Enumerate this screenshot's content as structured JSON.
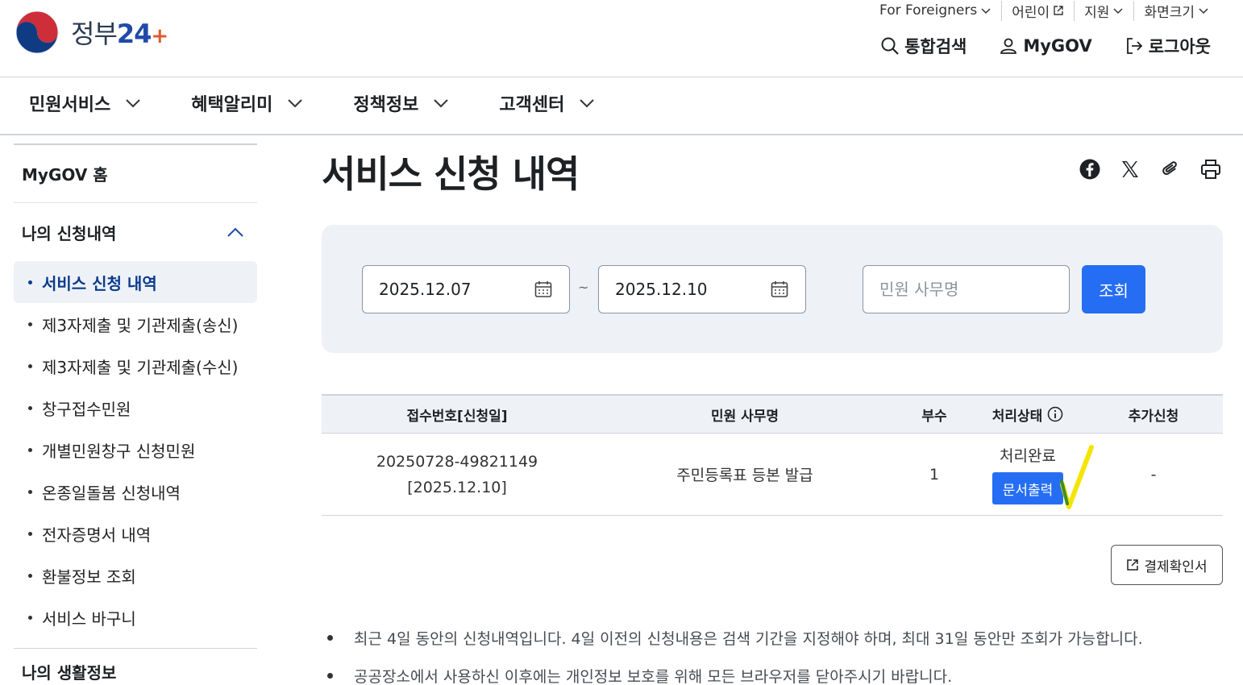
{
  "header": {
    "logo_text": "정부",
    "logo_num": "24",
    "logo_plus": "+",
    "util": [
      {
        "label": "For Foreigners",
        "icon": "chevron-down-icon"
      },
      {
        "label": "어린이",
        "icon": "external-link-icon"
      },
      {
        "label": "지원",
        "icon": "chevron-down-icon"
      },
      {
        "label": "화면크기",
        "icon": "chevron-down-icon"
      }
    ],
    "main_util": [
      {
        "label": "통합검색",
        "icon": "search-icon"
      },
      {
        "label": "MyGOV",
        "icon": "user-icon"
      },
      {
        "label": "로그아웃",
        "icon": "logout-icon"
      }
    ]
  },
  "gnb": [
    "민원서비스",
    "혜택알리미",
    "정책정보",
    "고객센터"
  ],
  "sidebar": {
    "home": "MyGOV 홈",
    "group": "나의 신청내역",
    "items": [
      {
        "label": "서비스 신청 내역",
        "active": true
      },
      {
        "label": "제3자제출 및 기관제출(송신)"
      },
      {
        "label": "제3자제출 및 기관제출(수신)"
      },
      {
        "label": "창구접수민원"
      },
      {
        "label": "개별민원창구 신청민원"
      },
      {
        "label": "온종일돌봄 신청내역"
      },
      {
        "label": "전자증명서 내역"
      },
      {
        "label": "환불정보 조회"
      },
      {
        "label": "서비스 바구니"
      }
    ],
    "group2": "나의 생활정보"
  },
  "page": {
    "title": "서비스 신청 내역"
  },
  "share_icons": [
    "facebook-icon",
    "x-icon",
    "clip-icon",
    "print-icon"
  ],
  "search": {
    "start_date": "2025.12.07",
    "end_date": "2025.12.10",
    "tilde": "~",
    "keyword_placeholder": "민원 사무명",
    "button": "조회"
  },
  "table": {
    "headers": [
      "접수번호[신청일]",
      "민원 사무명",
      "부수",
      "처리상태",
      "추가신청"
    ],
    "rows": [
      {
        "receipt_no": "20250728-49821149",
        "date": "[2025.12.10]",
        "name": "주민등록표 등본 발급",
        "count": "1",
        "status": "처리완료",
        "action": "문서출력",
        "extra": "-"
      }
    ]
  },
  "receipt_button": "결제확인서",
  "notes": [
    "최근 4일 동안의 신청내역입니다. 4일 이전의 신청내용은 검색 기간을 지정해야 하며, 최대 31일 동안만 조회가 가능합니다.",
    "공공장소에서 사용하신 이후에는 개인정보 보호를 위해 모든 브라우저를 닫아주시기 바랍니다."
  ],
  "colors": {
    "primary": "#256ef4",
    "bg_box": "#eef2f7",
    "active_text": "#0b3b8c",
    "check_mark": "#f5e400"
  }
}
